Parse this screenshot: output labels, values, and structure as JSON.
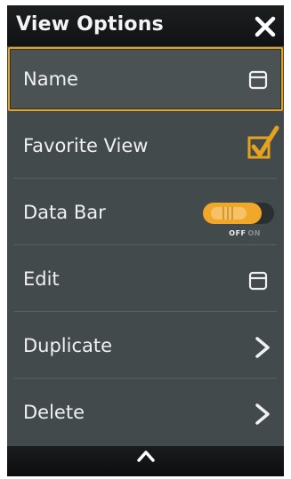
{
  "header": {
    "title": "View Options"
  },
  "rows": [
    {
      "label": "Name"
    },
    {
      "label": "Favorite View"
    },
    {
      "label": "Data Bar"
    },
    {
      "label": "Edit"
    },
    {
      "label": "Duplicate"
    },
    {
      "label": "Delete"
    }
  ],
  "data_bar_toggle": {
    "off_label": "OFF",
    "on_label": "ON",
    "state": "off"
  },
  "favorite_view_checked": true,
  "colors": {
    "accent": "#e4a21e",
    "panel": "#434a4c",
    "header": "#131516"
  },
  "icons": {
    "close": "close-icon",
    "name_action": "window-icon",
    "edit_action": "window-icon",
    "duplicate_action": "chevron-right-icon",
    "delete_action": "chevron-right-icon",
    "footer": "chevron-up-icon"
  }
}
